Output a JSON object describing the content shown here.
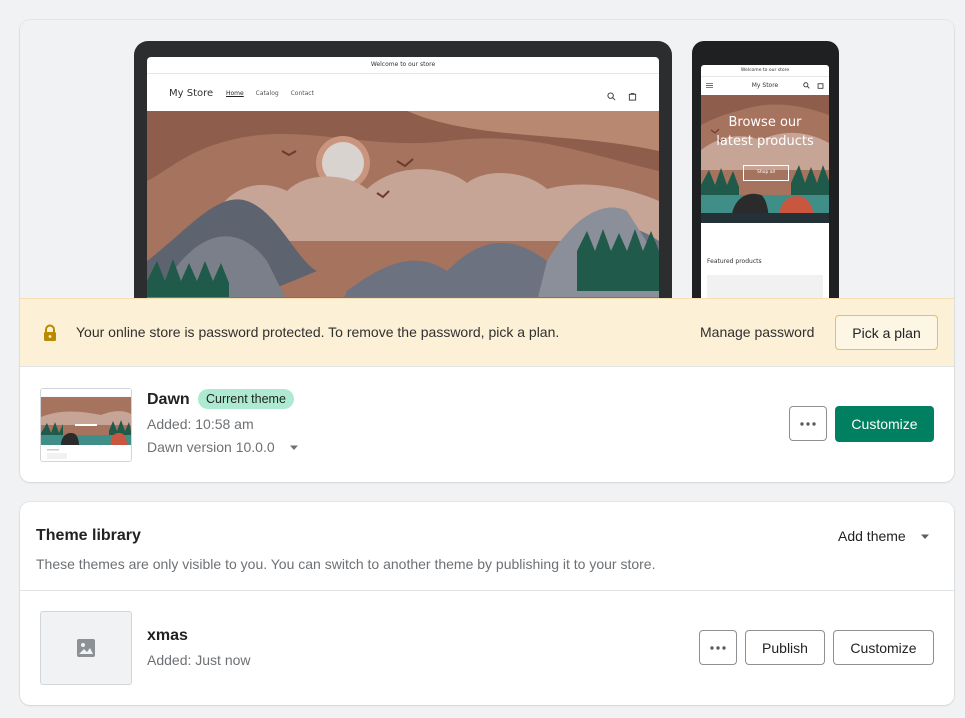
{
  "current_theme": {
    "preview": {
      "desktop": {
        "announcement": "Welcome to our store",
        "logo": "My Store",
        "nav": [
          "Home",
          "Catalog",
          "Contact"
        ]
      },
      "mobile": {
        "announcement": "Welcome to our store",
        "logo": "My Store",
        "hero_line1": "Browse our",
        "hero_line2": "latest products",
        "hero_button": "Shop all",
        "featured_heading": "Featured products"
      }
    },
    "banner": {
      "message": "Your online store is password protected. To remove the password, pick a plan.",
      "manage_label": "Manage password",
      "pick_label": "Pick a plan"
    },
    "name": "Dawn",
    "badge": "Current theme",
    "added": "Added: 10:58 am",
    "version": "Dawn version 10.0.0",
    "customize_label": "Customize"
  },
  "library": {
    "title": "Theme library",
    "description": "These themes are only visible to you. You can switch to another theme by publishing it to your store.",
    "add_theme_label": "Add theme",
    "themes": [
      {
        "name": "xmas",
        "added": "Added: Just now",
        "publish_label": "Publish",
        "customize_label": "Customize"
      }
    ]
  },
  "colors": {
    "primary": "#008060",
    "badge_bg": "#aee9d1",
    "banner_bg": "#fcf0d6",
    "banner_border": "#e0c06a"
  },
  "icons": [
    "lock-icon",
    "ellipsis-icon",
    "caret-down-icon",
    "image-placeholder-icon",
    "search-icon",
    "cart-icon",
    "menu-icon"
  ]
}
